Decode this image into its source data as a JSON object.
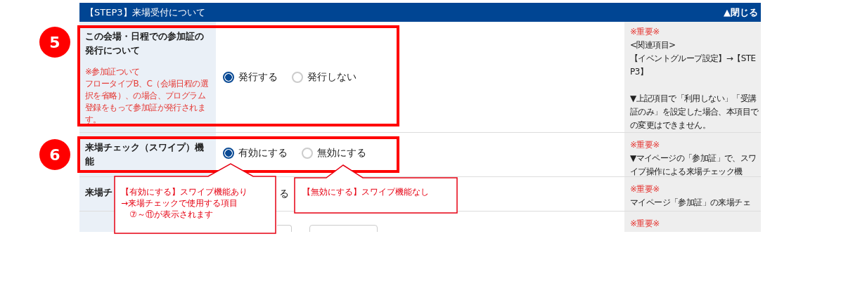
{
  "section": {
    "title": "【STEP3】来場受付について",
    "toggle": "▲閉じる"
  },
  "rows": [
    {
      "kind": "radio",
      "marker": "5",
      "label": "この会場・日程での参加証の発行について",
      "hint_title": "※参加証ついて",
      "hint": "フロータイプB、C（会場日程の選択を省略）、の場合、プログラム登録をもって参加証が発行されます。",
      "options": [
        {
          "label": "発行する",
          "selected": true
        },
        {
          "label": "発行しない",
          "selected": false
        }
      ],
      "note_title": "※重要※",
      "note": "<関連項目>\n【イベントグループ設定】→【STEP3】\n\n▼上記項目で「利用しない」「受講証のみ」を設定した場合、本項目での変更はできません。"
    },
    {
      "kind": "radio",
      "marker": "6",
      "label": "来場チェック（スワイプ）機能",
      "options": [
        {
          "label": "有効にする",
          "selected": true
        },
        {
          "label": "無効にする",
          "selected": false
        }
      ],
      "note_title": "※重要※",
      "note": "▼マイページの「参加証」で、スワイプ操作による来場チェック機"
    },
    {
      "kind": "partial",
      "label": "来場チ",
      "value": "る",
      "note_title": "※重要※",
      "note": "マイページ「参加証」の来場チェ"
    },
    {
      "kind": "fields",
      "fields": [
        {
          "kind": "text"
        },
        {
          "kind": "text"
        }
      ],
      "note_title": "※重要※"
    }
  ],
  "callouts": [
    {
      "text": "【有効にする】スワイプ機能あり\n→来場チェックで使用する項目\n　⑦～⑪が表示されます"
    },
    {
      "text": "【無効にする】スワイプ機能なし"
    }
  ]
}
